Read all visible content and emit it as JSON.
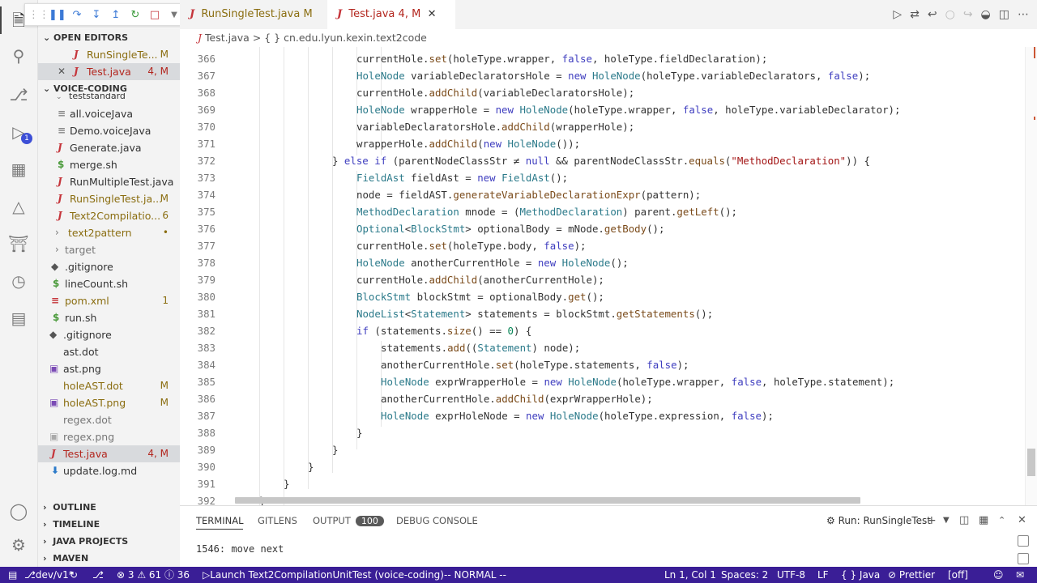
{
  "debug_toolbar": {
    "icons": [
      "grip",
      "pause",
      "step-over",
      "step-into",
      "step-out",
      "restart",
      "stop",
      "chevron-down"
    ]
  },
  "tabs": [
    {
      "label": "RunSingleTest.java",
      "status": "M",
      "active": false
    },
    {
      "label": "Test.java",
      "status": "4, M",
      "active": true
    }
  ],
  "breadcrumb": {
    "file": "Test.java",
    "sep": ">",
    "scope": "{ } cn.edu.lyun.kexin.text2code"
  },
  "sidebar": {
    "open_editors_title": "OPEN EDITORS",
    "open_editors": [
      {
        "label": "RunSingleTe...",
        "status": "M"
      },
      {
        "label": "Test.java",
        "status": "4, M"
      }
    ],
    "project_title": "VOICE-CODING",
    "files": [
      {
        "label": "teststandard",
        "status": ""
      },
      {
        "label": "all.voiceJava",
        "status": ""
      },
      {
        "label": "Demo.voiceJava",
        "status": ""
      },
      {
        "label": "Generate.java",
        "status": ""
      },
      {
        "label": "merge.sh",
        "status": ""
      },
      {
        "label": "RunMultipleTest.java",
        "status": ""
      },
      {
        "label": "RunSingleTest.ja...",
        "status": "M"
      },
      {
        "label": "Text2Compilatio...",
        "status": "6"
      },
      {
        "label": "text2pattern",
        "status": "•"
      },
      {
        "label": "target",
        "status": ""
      },
      {
        "label": ".gitignore",
        "status": ""
      },
      {
        "label": "lineCount.sh",
        "status": ""
      },
      {
        "label": "pom.xml",
        "status": "1"
      },
      {
        "label": "run.sh",
        "status": ""
      },
      {
        "label": ".gitignore",
        "status": ""
      },
      {
        "label": "ast.dot",
        "status": ""
      },
      {
        "label": "ast.png",
        "status": ""
      },
      {
        "label": "holeAST.dot",
        "status": "M"
      },
      {
        "label": "holeAST.png",
        "status": "M"
      },
      {
        "label": "regex.dot",
        "status": ""
      },
      {
        "label": "regex.png",
        "status": ""
      },
      {
        "label": "Test.java",
        "status": "4, M"
      },
      {
        "label": "update.log.md",
        "status": ""
      }
    ],
    "bottom_sections": [
      "OUTLINE",
      "TIMELINE",
      "JAVA PROJECTS",
      "MAVEN"
    ]
  },
  "editor": {
    "lines": [
      {
        "n": "366",
        "code": "currentHole.set(holeType.wrapper, false, holeType.fieldDeclaration);"
      },
      {
        "n": "367",
        "code": "HoleNode variableDeclaratorsHole = new HoleNode(holeType.variableDeclarators, false);"
      },
      {
        "n": "368",
        "code": "currentHole.addChild(variableDeclaratorsHole);"
      },
      {
        "n": "369",
        "code": "HoleNode wrapperHole = new HoleNode(holeType.wrapper, false, holeType.variableDeclarator);"
      },
      {
        "n": "370",
        "code": "variableDeclaratorsHole.addChild(wrapperHole);"
      },
      {
        "n": "371",
        "code": "wrapperHole.addChild(new HoleNode());"
      },
      {
        "n": "372",
        "code": "} else if (parentNodeClassStr ≠ null && parentNodeClassStr.equals(\"MethodDeclaration\")) {"
      },
      {
        "n": "373",
        "code": "FieldAst fieldAst = new FieldAst();"
      },
      {
        "n": "374",
        "code": "node = fieldAST.generateVariableDeclarationExpr(pattern);"
      },
      {
        "n": "375",
        "code": "MethodDeclaration mnode = (MethodDeclaration) parent.getLeft();"
      },
      {
        "n": "376",
        "code": "Optional<BlockStmt> optionalBody = mNode.getBody();"
      },
      {
        "n": "377",
        "code": "currentHole.set(holeType.body, false);"
      },
      {
        "n": "378",
        "code": "HoleNode anotherCurrentHole = new HoleNode();"
      },
      {
        "n": "379",
        "code": "currentHole.addChild(anotherCurrentHole);"
      },
      {
        "n": "380",
        "code": "BlockStmt blockStmt = optionalBody.get();"
      },
      {
        "n": "381",
        "code": "NodeList<Statement> statements = blockStmt.getStatements();"
      },
      {
        "n": "382",
        "code": "if (statements.size() == 0) {"
      },
      {
        "n": "383",
        "code": "statements.add((Statement) node);"
      },
      {
        "n": "384",
        "code": "anotherCurrentHole.set(holeType.statements, false);"
      },
      {
        "n": "385",
        "code": "HoleNode exprWrapperHole = new HoleNode(holeType.wrapper, false, holeType.statement);"
      },
      {
        "n": "386",
        "code": "anotherCurrentHole.addChild(exprWrapperHole);"
      },
      {
        "n": "387",
        "code": "HoleNode exprHoleNode = new HoleNode(holeType.expression, false);"
      },
      {
        "n": "388",
        "code": "}"
      },
      {
        "n": "389",
        "code": "}"
      },
      {
        "n": "390",
        "code": "}"
      },
      {
        "n": "391",
        "code": "}"
      },
      {
        "n": "392",
        "code": "}"
      }
    ]
  },
  "panel": {
    "tabs": [
      "TERMINAL",
      "GITLENS",
      "OUTPUT",
      "DEBUG CONSOLE"
    ],
    "output_badge": "100",
    "run_label": "Run: RunSingleTest",
    "terminal_text": "1546: move next"
  },
  "statusbar": {
    "branch": "dev/v1*",
    "problems": "⊗ 3 ⚠ 61 ⓘ 36",
    "launch": "Launch Text2CompilationUnitTest (voice-coding)",
    "mode": "-- NORMAL --",
    "position": "Ln 1, Col 1",
    "spaces": "Spaces: 2",
    "encoding": "UTF-8",
    "eol": "LF",
    "language": "{ } Java",
    "prettier": "⊘ Prettier",
    "off": "[off]"
  }
}
